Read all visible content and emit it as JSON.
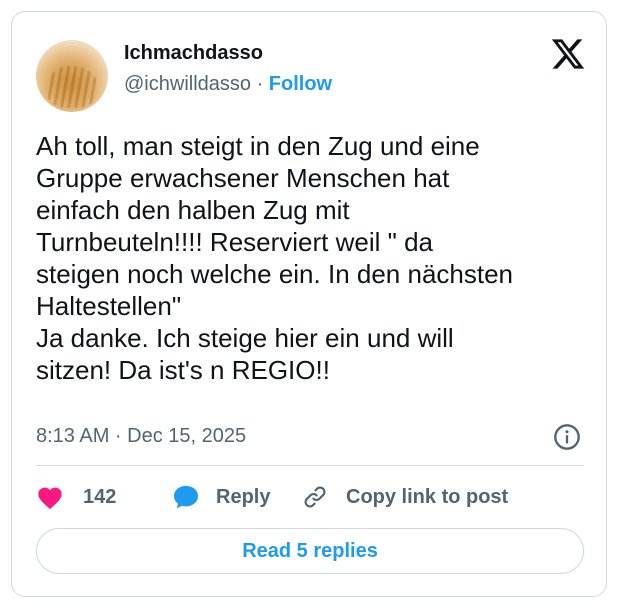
{
  "author": {
    "display_name": "Ichmachdasso",
    "handle": "@ichwilldasso",
    "separator": " · ",
    "follow_label": "Follow"
  },
  "tweet": {
    "text": "Ah toll, man steigt in den Zug und eine\nGruppe erwachsener Menschen hat\neinfach den halben Zug mit\nTurnbeuteln!!!! Reserviert weil \" da\nsteigen noch welche ein. In den nächsten\nHaltestellen\"\nJa danke. Ich steige hier ein und will\nsitzen! Da ist's n REGIO!!",
    "timestamp": "8:13 AM · Dec 15, 2025"
  },
  "actions": {
    "like_count": "142",
    "reply_label": "Reply",
    "copy_link_label": "Copy link to post"
  },
  "footer": {
    "read_replies_label": "Read 5 replies"
  },
  "colors": {
    "accent": "#1d9bf0",
    "like": "#f91880",
    "secondary_text": "#536471",
    "border": "#cfd9de"
  },
  "icons": [
    "x-logo-icon",
    "info-icon",
    "heart-icon",
    "reply-bubble-icon",
    "link-icon"
  ]
}
